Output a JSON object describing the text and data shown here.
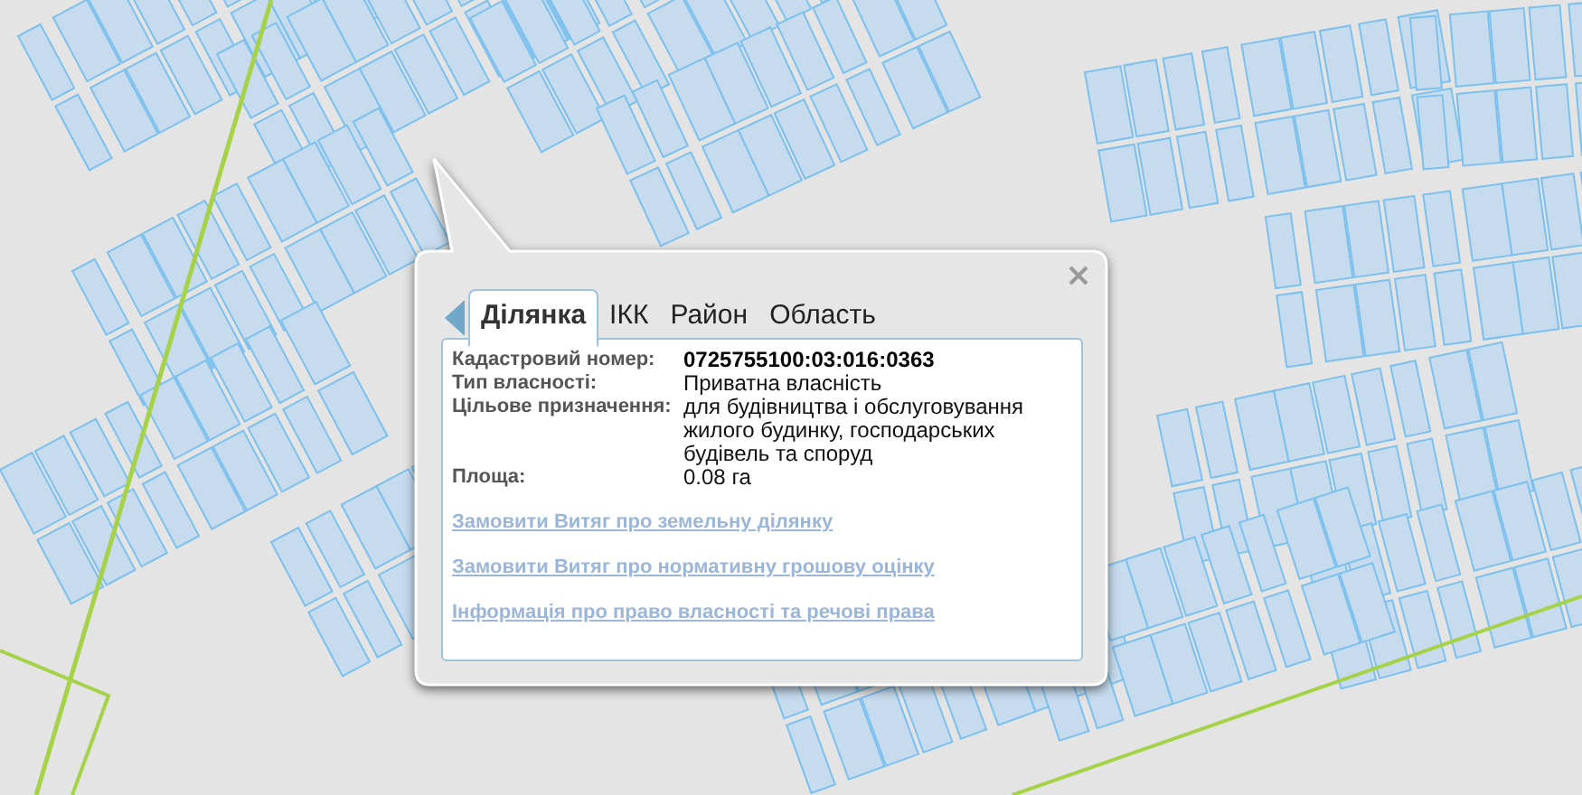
{
  "popup": {
    "tabs": [
      {
        "label": "Ділянка",
        "selected": true
      },
      {
        "label": "ІКК",
        "selected": false
      },
      {
        "label": "Район",
        "selected": false
      },
      {
        "label": "Область",
        "selected": false
      }
    ],
    "fields": [
      {
        "label": "Кадастровий номер:",
        "value": "0725755100:03:016:0363",
        "emphasized": true
      },
      {
        "label": "Тип власності:",
        "value": "Приватна власність",
        "emphasized": false
      },
      {
        "label": "Цільове призначення:",
        "value": "для будівництва і обслуговування жилого будинку, господарських будівель та споруд",
        "emphasized": false
      },
      {
        "label": "Площа:",
        "value": "0.08 га",
        "emphasized": false
      }
    ],
    "links": [
      "Замовити Витяг про земельну ділянку",
      "Замовити Витяг про нормативну грошову оцінку",
      "Інформація про право власності та речові права"
    ]
  }
}
